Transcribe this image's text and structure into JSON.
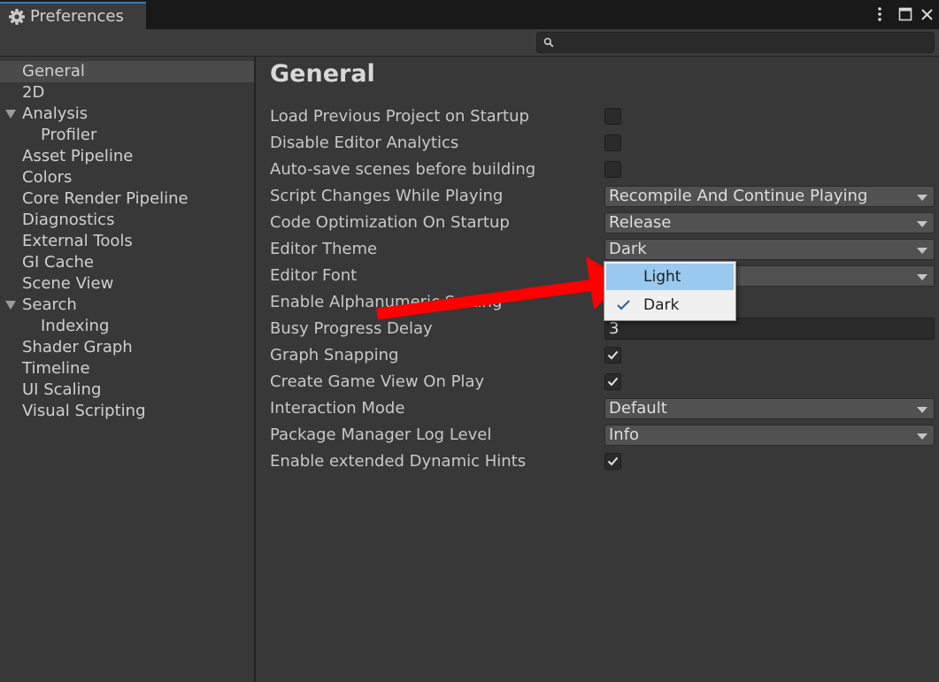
{
  "window": {
    "tab_title": "Preferences",
    "tab_icon": "gear-icon",
    "controls": [
      "more-vert-icon",
      "maximize-icon",
      "close-icon"
    ]
  },
  "search": {
    "value": "",
    "placeholder": "",
    "icon": "search-icon"
  },
  "sidebar": {
    "items": [
      {
        "label": "General",
        "selected": true
      },
      {
        "label": "2D"
      },
      {
        "label": "Analysis",
        "expanded": true
      },
      {
        "label": "Profiler"
      },
      {
        "label": "Asset Pipeline"
      },
      {
        "label": "Colors"
      },
      {
        "label": "Core Render Pipeline"
      },
      {
        "label": "Diagnostics"
      },
      {
        "label": "External Tools"
      },
      {
        "label": "GI Cache"
      },
      {
        "label": "Scene View"
      },
      {
        "label": "Search",
        "expanded": true
      },
      {
        "label": "Indexing"
      },
      {
        "label": "Shader Graph"
      },
      {
        "label": "Timeline"
      },
      {
        "label": "UI Scaling"
      },
      {
        "label": "Visual Scripting"
      }
    ]
  },
  "main": {
    "title": "General",
    "rows": [
      {
        "label": "Load Previous Project on Startup",
        "type": "checkbox",
        "checked": false
      },
      {
        "label": "Disable Editor Analytics",
        "type": "checkbox",
        "checked": false
      },
      {
        "label": "Auto-save scenes before building",
        "type": "checkbox",
        "checked": false
      },
      {
        "label": "Script Changes While Playing",
        "type": "dropdown",
        "value": "Recompile And Continue Playing"
      },
      {
        "label": "Code Optimization On Startup",
        "type": "dropdown",
        "value": "Release"
      },
      {
        "label": "Editor Theme",
        "type": "dropdown",
        "value": "Dark"
      },
      {
        "label": "Editor Font",
        "type": "dropdown",
        "value": ""
      },
      {
        "label": "Enable Alphanumeric Sorting",
        "type": "checkbox",
        "checked": false
      },
      {
        "label": "Busy Progress Delay",
        "type": "number",
        "value": "3"
      },
      {
        "label": "Graph Snapping",
        "type": "checkbox",
        "checked": true
      },
      {
        "label": "Create Game View On Play",
        "type": "checkbox",
        "checked": true
      },
      {
        "label": "Interaction Mode",
        "type": "dropdown",
        "value": "Default"
      },
      {
        "label": "Package Manager Log Level",
        "type": "dropdown",
        "value": "Info"
      },
      {
        "label": "Enable extended Dynamic Hints",
        "type": "checkbox",
        "checked": true
      }
    ]
  },
  "theme_popup": {
    "options": [
      {
        "label": "Light",
        "highlighted": true,
        "checked": false
      },
      {
        "label": "Dark",
        "highlighted": false,
        "checked": true
      }
    ]
  },
  "annotation": {
    "type": "arrow",
    "color": "#ff0000",
    "points_to": "Light"
  },
  "colors": {
    "background": "#383838",
    "titlebar": "#191919",
    "tab_accent": "#3a79bb",
    "selection": "#4b4b4b",
    "dropdown": "#515151",
    "popup_highlight": "#99c9ef"
  }
}
